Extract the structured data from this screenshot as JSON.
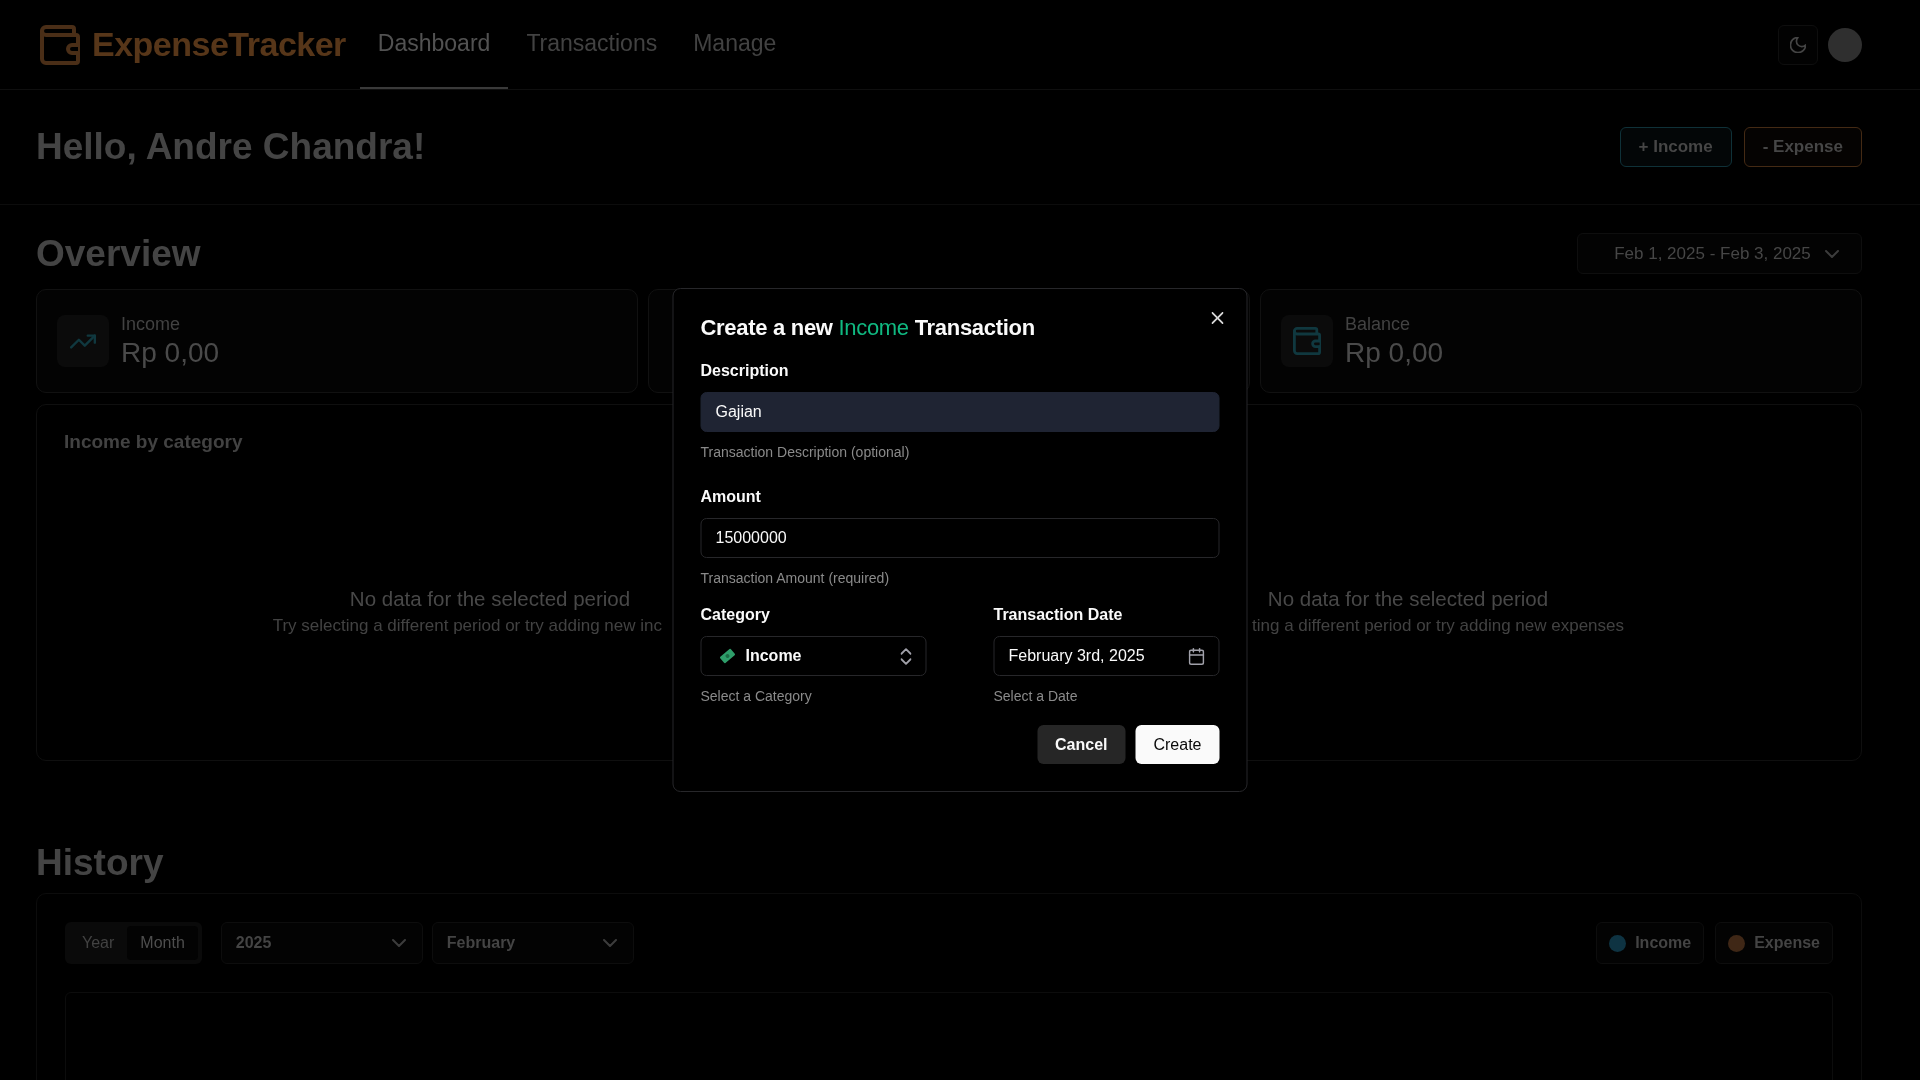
{
  "header": {
    "brand": "ExpenseTracker",
    "nav": [
      {
        "label": "Dashboard",
        "selected": true
      },
      {
        "label": "Transactions",
        "selected": false
      },
      {
        "label": "Manage",
        "selected": false
      }
    ]
  },
  "greeting": {
    "text": "Hello, Andre Chandra!",
    "actions": [
      {
        "label": "+ Income",
        "kind": "income"
      },
      {
        "label": "- Expense",
        "kind": "expense"
      }
    ]
  },
  "overview": {
    "title": "Overview",
    "date_range": "Feb 1, 2025 - Feb 3, 2025",
    "cards": [
      {
        "kind": "income",
        "label": "Income",
        "value": "Rp 0,00"
      },
      {
        "kind": "covered"
      },
      {
        "kind": "balance",
        "label": "Balance",
        "value": "Rp 0,00"
      }
    ],
    "panels": [
      {
        "title": "Income by category",
        "empty_title": "No data for the selected period",
        "empty_hint": "Try selecting a different period or try adding new inc"
      },
      {
        "empty_title": "No data for the selected period",
        "empty_hint": "ting a different period or try adding new expenses"
      }
    ]
  },
  "history": {
    "title": "History",
    "view_toggle": [
      {
        "label": "Year",
        "selected": false
      },
      {
        "label": "Month",
        "selected": true
      }
    ],
    "year_select": "2025",
    "month_select": "February",
    "legend": [
      {
        "label": "Income",
        "color": "#0e3342"
      },
      {
        "label": "Expense",
        "color": "#3f2716"
      }
    ]
  },
  "dialog": {
    "title": {
      "before": "Create a new",
      "highlight": "Income",
      "after": "Transaction"
    },
    "fields": [
      {
        "kind": "text",
        "label": "Description",
        "value": "Gajian",
        "autofilled": true,
        "hint": "Transaction Description (optional)"
      },
      {
        "kind": "text",
        "label": "Amount",
        "value": "15000000",
        "autofilled": false,
        "hint": "Transaction Amount (required)"
      },
      {
        "kind": "select",
        "label": "Category",
        "value": "Income",
        "hint": "Select a Category"
      },
      {
        "kind": "date",
        "label": "Transaction Date",
        "value": "February 3rd, 2025",
        "hint": "Select a Date"
      }
    ],
    "buttons": [
      {
        "label": "Cancel",
        "kind": "secondary"
      },
      {
        "label": "Create",
        "kind": "primary"
      }
    ]
  }
}
